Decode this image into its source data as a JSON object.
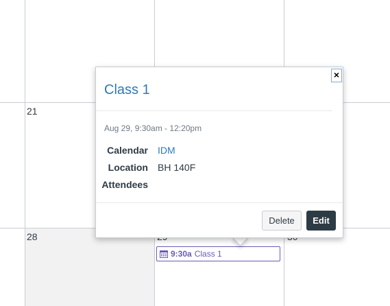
{
  "calendar": {
    "day_numbers": [
      "21",
      "28",
      "29",
      "30"
    ]
  },
  "event": {
    "time": "9:30a",
    "title": "Class 1",
    "accent_color": "#6b5bb0",
    "icon": "calendar-icon"
  },
  "popover": {
    "close_label": "×",
    "title": "Class 1",
    "date_range": "Aug 29, 9:30am - 12:20pm",
    "fields": [
      {
        "label": "Calendar",
        "value": "IDM"
      },
      {
        "label": "Location",
        "value": "BH 140F"
      },
      {
        "label": "Attendees",
        "value": ""
      }
    ],
    "delete_label": "Delete",
    "edit_label": "Edit",
    "link_color": "#2b7abc"
  }
}
